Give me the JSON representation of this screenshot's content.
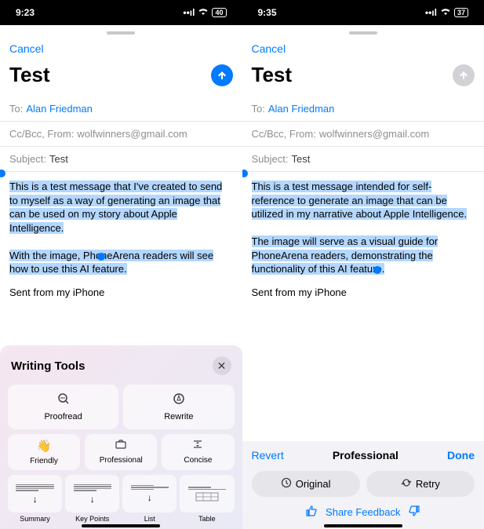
{
  "left": {
    "status": {
      "time": "9:23",
      "battery": "40"
    },
    "cancel": "Cancel",
    "title": "Test",
    "to_label": "To:",
    "to_value": "Alan Friedman",
    "cc_label": "Cc/Bcc, From:",
    "cc_value": "wolfwinners@gmail.com",
    "subject_label": "Subject:",
    "subject_value": "Test",
    "body_p1": "This is a test message that I've created to send to myself as a way of generating an image that can be used on my story about Apple Intelligence.",
    "body_p2": "With the image, PhoneArena readers will see how to use this AI feature.",
    "signature": "Sent from my iPhone",
    "wt_title": "Writing Tools",
    "wt_proofread": "Proofread",
    "wt_rewrite": "Rewrite",
    "wt_friendly": "Friendly",
    "wt_professional": "Professional",
    "wt_concise": "Concise",
    "wt_summary": "Summary",
    "wt_keypoints": "Key Points",
    "wt_list": "List",
    "wt_table": "Table"
  },
  "right": {
    "status": {
      "time": "9:35",
      "battery": "37"
    },
    "cancel": "Cancel",
    "title": "Test",
    "to_label": "To:",
    "to_value": "Alan Friedman",
    "cc_label": "Cc/Bcc, From:",
    "cc_value": "wolfwinners@gmail.com",
    "subject_label": "Subject:",
    "subject_value": "Test",
    "body_p1": "This is a test message intended for self-reference to generate an image that can be utilized in my narrative about Apple Intelligence.",
    "body_p2": "The image will serve as a visual guide for PhoneArena readers, demonstrating the functionality of this AI feature.",
    "signature": "Sent from my iPhone",
    "revert": "Revert",
    "mode": "Professional",
    "done": "Done",
    "original": "Original",
    "retry": "Retry",
    "share_feedback": "Share Feedback"
  }
}
